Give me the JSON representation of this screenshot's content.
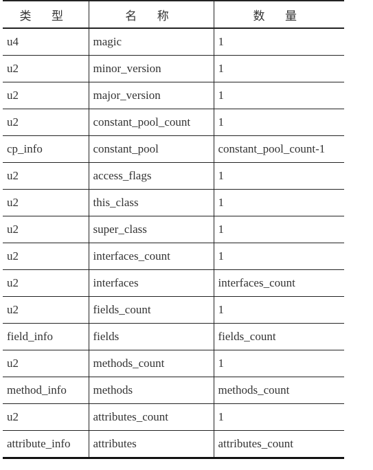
{
  "headers": [
    "类 型",
    "名 称",
    "数 量"
  ],
  "rows": [
    [
      "u4",
      "magic",
      "1"
    ],
    [
      "u2",
      "minor_version",
      "1"
    ],
    [
      "u2",
      "major_version",
      "1"
    ],
    [
      "u2",
      "constant_pool_count",
      "1"
    ],
    [
      "cp_info",
      "constant_pool",
      "constant_pool_count-1"
    ],
    [
      "u2",
      "access_flags",
      "1"
    ],
    [
      "u2",
      "this_class",
      "1"
    ],
    [
      "u2",
      "super_class",
      "1"
    ],
    [
      "u2",
      "interfaces_count",
      "1"
    ],
    [
      "u2",
      "interfaces",
      "interfaces_count"
    ],
    [
      "u2",
      "fields_count",
      "1"
    ],
    [
      "field_info",
      "fields",
      "fields_count"
    ],
    [
      "u2",
      "methods_count",
      "1"
    ],
    [
      "method_info",
      "methods",
      "methods_count"
    ],
    [
      "u2",
      "attributes_count",
      "1"
    ],
    [
      "attribute_info",
      "attributes",
      "attributes_count"
    ]
  ]
}
